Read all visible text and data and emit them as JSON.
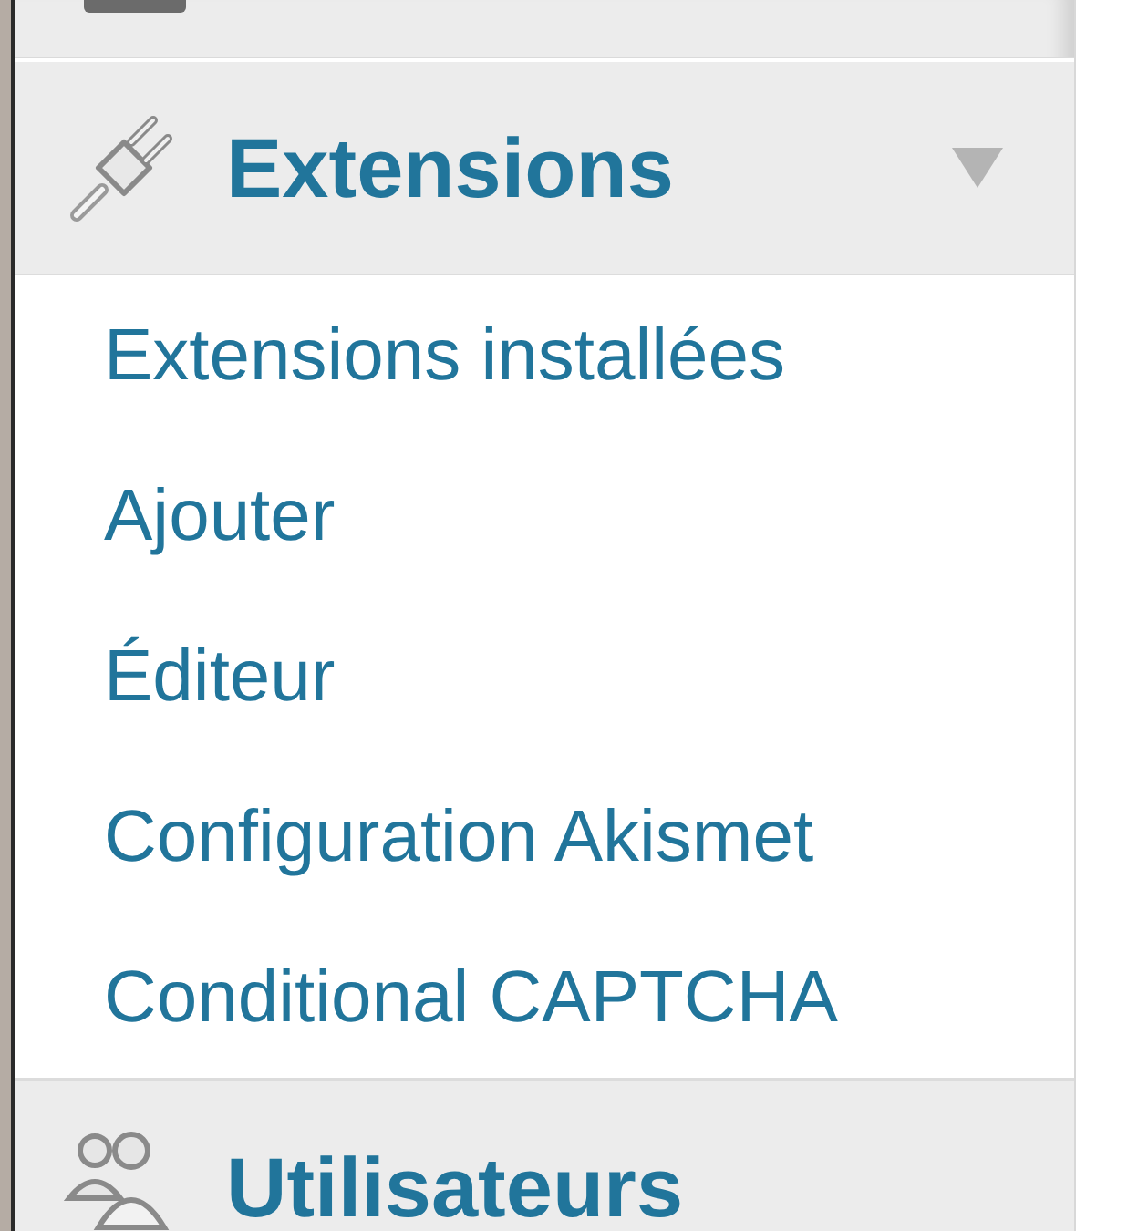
{
  "menu": [
    {
      "label": "Extensions",
      "expanded": true,
      "children": [
        {
          "label": "Extensions installées",
          "selected": false
        },
        {
          "label": "Ajouter",
          "selected": false
        },
        {
          "label": "Éditeur",
          "selected": false
        },
        {
          "label": "Configuration Akismet",
          "selected": false
        },
        {
          "label": "Conditional CAPTCHA",
          "selected": false
        }
      ]
    },
    {
      "label": "Utilisateurs",
      "expanded": false
    }
  ]
}
